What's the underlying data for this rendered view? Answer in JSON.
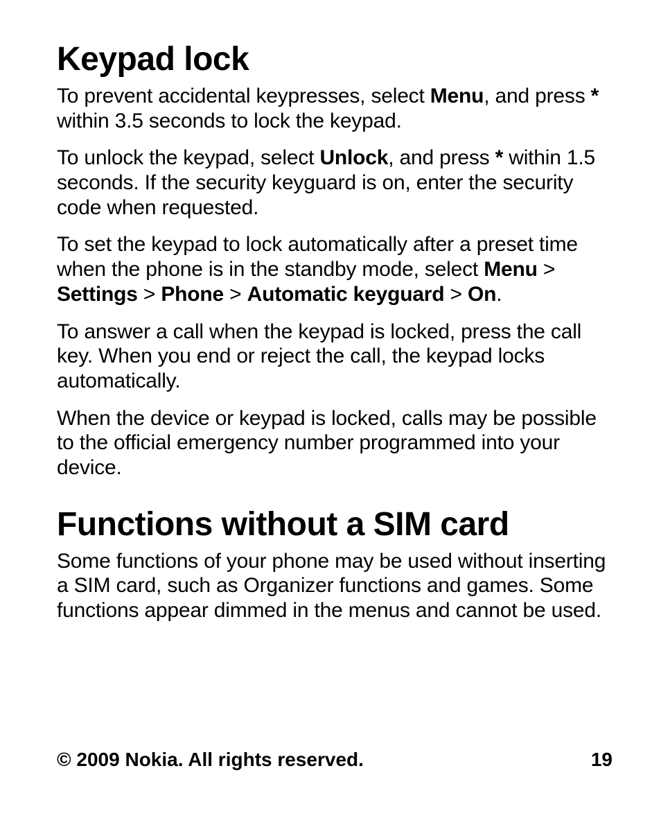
{
  "section1": {
    "heading": "Keypad lock",
    "p1": {
      "t1": "To prevent accidental keypresses, select ",
      "b1": "Menu",
      "t2": ", and press ",
      "b2": "*",
      "t3": " within 3.5 seconds to lock the keypad."
    },
    "p2": {
      "t1": "To unlock the keypad, select ",
      "b1": "Unlock",
      "t2": ", and press ",
      "b2": "*",
      "t3": " within 1.5 seconds. If the security keyguard is on, enter the security code when requested."
    },
    "p3": {
      "t1": "To set the keypad to lock automatically after a preset time when the phone is in the standby mode, select ",
      "b1": "Menu",
      "s1": " > ",
      "b2": "Settings",
      "s2": " > ",
      "b3": "Phone",
      "s3": " > ",
      "b4": "Automatic keyguard",
      "s4": " > ",
      "b5": "On",
      "t2": "."
    },
    "p4": "To answer a call when the keypad is locked, press the call key. When you end or reject the call, the keypad locks automatically.",
    "p5": "When the device or keypad is locked, calls may be possible to the official emergency number programmed into your device."
  },
  "section2": {
    "heading": "Functions without a SIM card",
    "p1": "Some functions of your phone may be used without inserting a SIM card, such as Organizer functions and games. Some functions appear dimmed in the menus and cannot be used."
  },
  "footer": {
    "copyright": "© 2009 Nokia. All rights reserved.",
    "page": "19"
  }
}
